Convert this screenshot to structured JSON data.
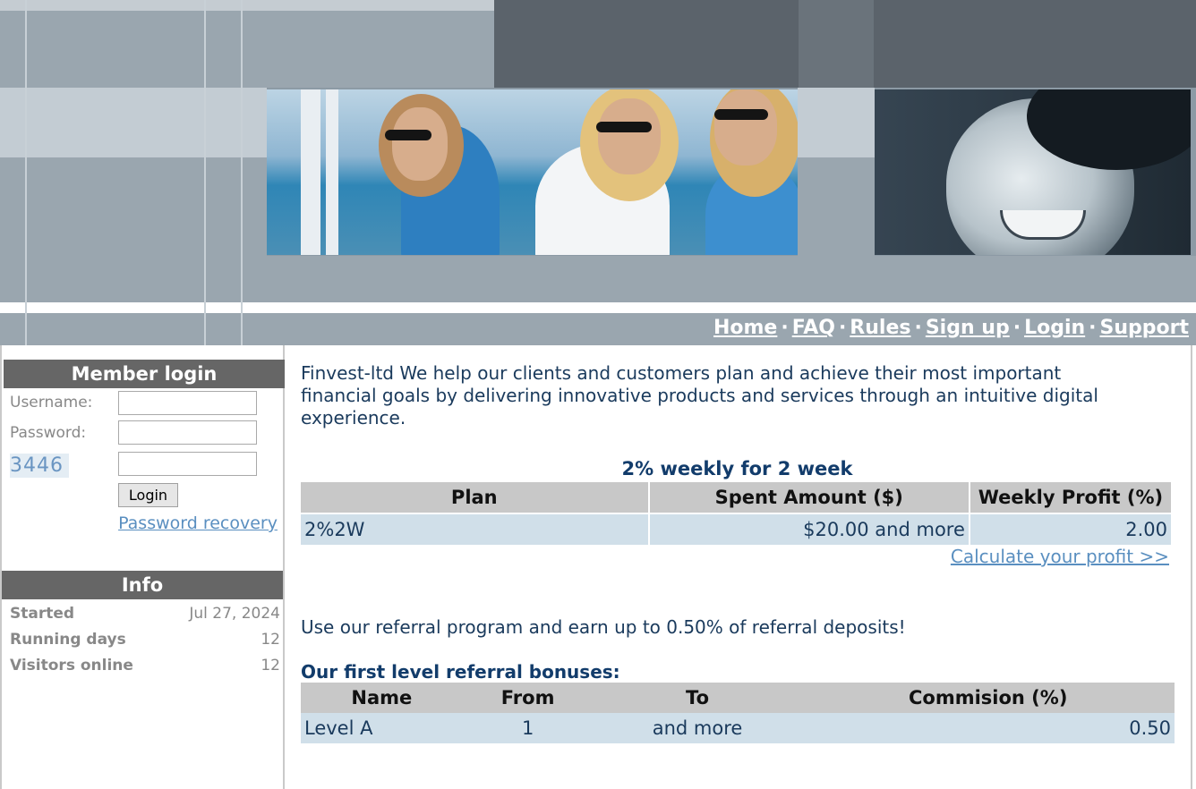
{
  "nav": {
    "home": "Home",
    "faq": "FAQ",
    "rules": "Rules",
    "signup": "Sign up",
    "login": "Login",
    "support": "Support",
    "separator": "·"
  },
  "member_login": {
    "title": "Member login",
    "username_label": "Username:",
    "password_label": "Password:",
    "captcha_code": "3446",
    "login_button": "Login",
    "password_recovery": "Password recovery"
  },
  "info": {
    "title": "Info",
    "rows": [
      {
        "label": "Started",
        "value": "Jul 27, 2024"
      },
      {
        "label": "Running days",
        "value": "12"
      },
      {
        "label": "Visitors online",
        "value": "12"
      }
    ]
  },
  "main": {
    "intro": "Finvest-ltd We help our clients and customers plan and achieve their most important financial goals by delivering innovative products and services through an intuitive digital experience.",
    "plan": {
      "title": "2% weekly for 2 week",
      "headers": [
        "Plan",
        "Spent Amount ($)",
        "Weekly Profit (%)"
      ],
      "row": [
        "2%2W",
        "$20.00 and more",
        "2.00"
      ]
    },
    "calculate_link": "Calculate your profit >>",
    "referral_text": "Use our referral program and earn up to 0.50% of referral deposits!",
    "referral_title": "Our first level referral bonuses:",
    "referral": {
      "headers": [
        "Name",
        "From",
        "To",
        "Commision (%)"
      ],
      "row": [
        "Level A",
        "1",
        "and more",
        "0.50"
      ]
    }
  }
}
